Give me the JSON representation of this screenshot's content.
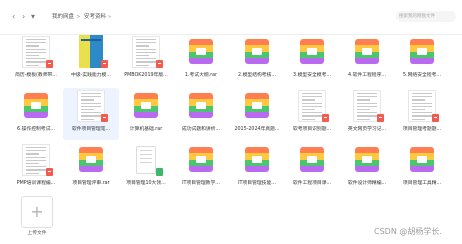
{
  "toolbar": {
    "back_icon": "chevron-left-icon",
    "forward_icon": "chevron-right-icon",
    "dropdown_icon": "chevron-down-icon",
    "back_label": "‹",
    "forward_label": "›",
    "dropdown_label": "▾"
  },
  "breadcrumb": {
    "root": "我的网盘",
    "sep1": ">",
    "current": "安考资料",
    "sep2": "»"
  },
  "search": {
    "placeholder": "搜索我的网盘文件"
  },
  "rows": [
    [
      {
        "name": "简历-模板(教师带...",
        "type": "doc",
        "badge": "pdf"
      },
      {
        "name": "中级-实践能力模...",
        "type": "cover",
        "badge": "pdf"
      },
      {
        "name": "PMBOK2019年版...",
        "type": "doc",
        "badge": "pdf"
      },
      {
        "name": "1.考试大纲.rar",
        "type": "zip"
      },
      {
        "name": "2.模型结构考核...",
        "type": "zip"
      },
      {
        "name": "3.模型安全模考...",
        "type": "zip"
      },
      {
        "name": "4.软件工程程序...",
        "type": "zip"
      },
      {
        "name": "5.网络安全程考...",
        "type": "zip"
      }
    ],
    [
      {
        "name": "6.操作控制考试...",
        "type": "zip"
      },
      {
        "name": "软件项目管理笔...",
        "type": "doc",
        "badge": "pdf",
        "selected": true
      },
      {
        "name": "计算机基础.rar",
        "type": "zip"
      },
      {
        "name": "成功试题和讲析...",
        "type": "zip"
      },
      {
        "name": "2015-2024年真题...",
        "type": "zip"
      },
      {
        "name": "软考项目识别题...",
        "type": "doc",
        "badge": "pdf"
      },
      {
        "name": "英文网页学习记...",
        "type": "doc",
        "badge": "pdf"
      },
      {
        "name": "项目管理考题题...",
        "type": "doc",
        "badge": "pdf"
      }
    ],
    [
      {
        "name": "PMP培训课程编...",
        "type": "doc",
        "badge": "pdf"
      },
      {
        "name": "项目管理评审.rar",
        "type": "zip"
      },
      {
        "name": "项目管理10大领...",
        "type": "plain",
        "badge": "xls"
      },
      {
        "name": "IT项目管理教学...",
        "type": "zip"
      },
      {
        "name": "IT项目管理技能...",
        "type": "zip"
      },
      {
        "name": "软件工程项目课...",
        "type": "zip"
      },
      {
        "name": "软件设计师精编...",
        "type": "zip"
      },
      {
        "name": "项目管理工具精...",
        "type": "zip"
      }
    ]
  ],
  "upload": {
    "label": "上传文件",
    "icon": "plus-icon",
    "plus": "+"
  },
  "watermark": "CSDN @胡杨学长."
}
